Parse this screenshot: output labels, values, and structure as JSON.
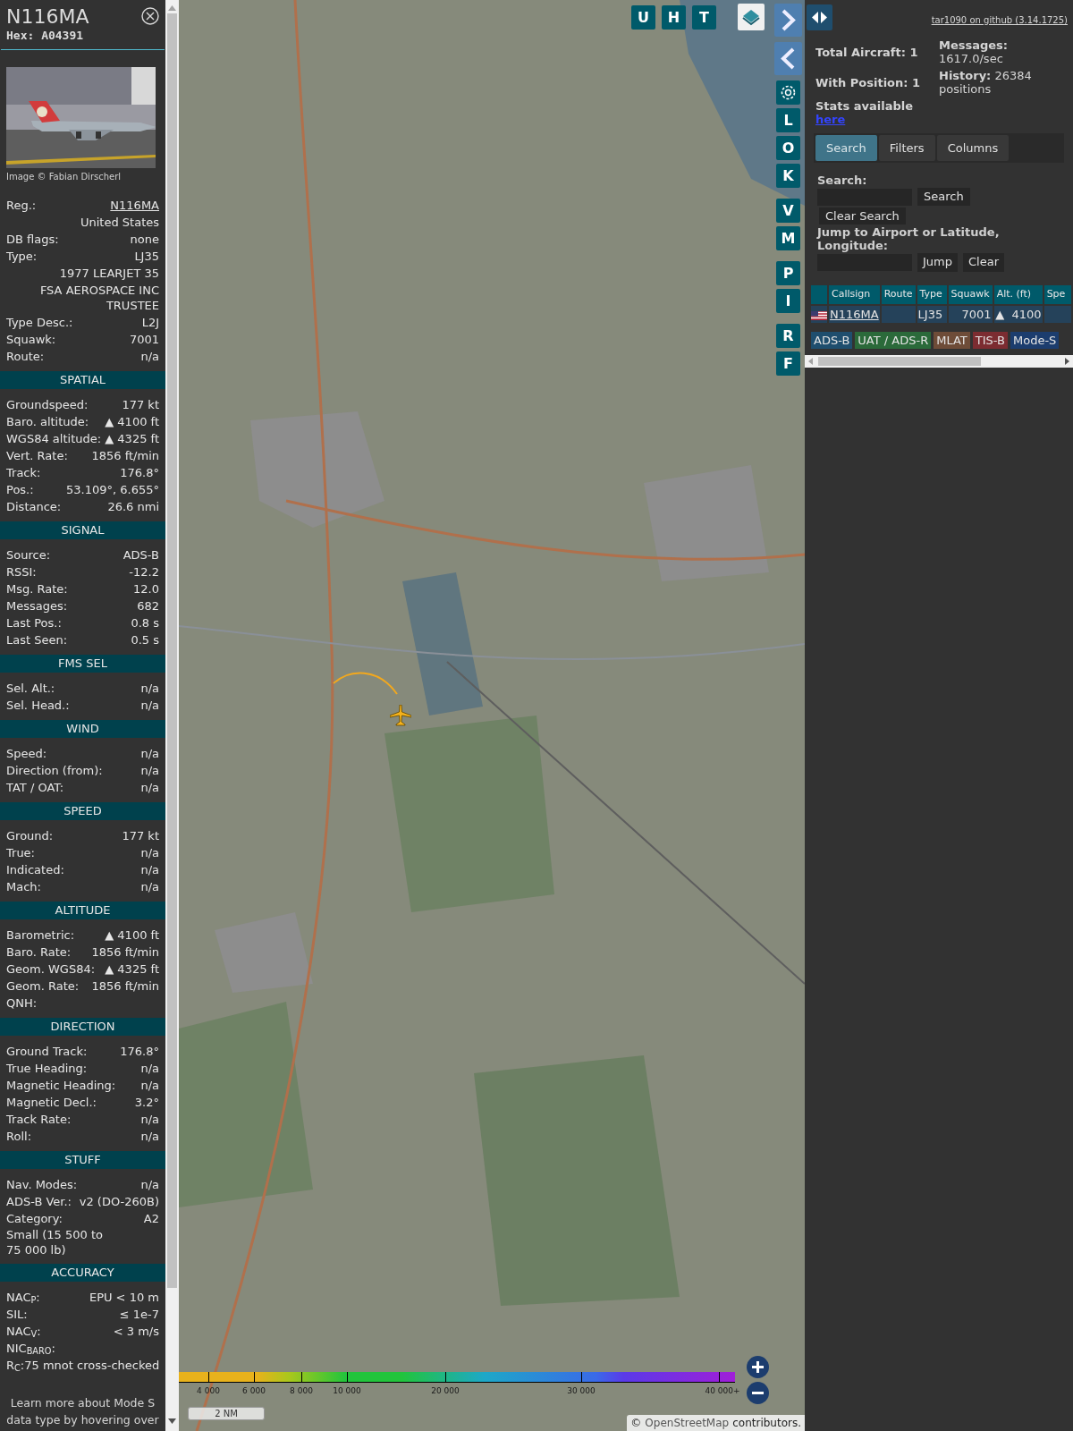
{
  "aircraft": {
    "callsign": "N116MA",
    "hex": "Hex: A04391"
  },
  "photo": {
    "kind": "picture",
    "credit": "Image © Fabian Dirscherl"
  },
  "details": [
    {
      "kind": "pair",
      "label": "Reg.:",
      "value": "N116MA",
      "link": true
    },
    {
      "kind": "value",
      "value": "United States"
    },
    {
      "kind": "pair",
      "label": "DB flags:",
      "value": "none"
    },
    {
      "kind": "pair",
      "label": "Type:",
      "value": "LJ35"
    },
    {
      "kind": "value",
      "value": "1977 LEARJET 35"
    },
    {
      "kind": "value",
      "value": "FSA AEROSPACE INC TRUSTEE"
    },
    {
      "kind": "pair",
      "label": "Type Desc.:",
      "value": "L2J"
    },
    {
      "kind": "pair",
      "label": "Squawk:",
      "value": "7001"
    },
    {
      "kind": "pair",
      "label": "Route:",
      "value": "n/a"
    }
  ],
  "sections": [
    {
      "title": "SPATIAL",
      "rows": [
        {
          "kind": "pair",
          "label": "Groundspeed:",
          "value": "177 kt"
        },
        {
          "kind": "pair",
          "label": "Baro. altitude:",
          "value": "▲ 4100 ft"
        },
        {
          "kind": "pair",
          "label": "WGS84 altitude:",
          "value": "▲ 4325 ft"
        },
        {
          "kind": "pair",
          "label": "Vert. Rate:",
          "value": "1856 ft/min"
        },
        {
          "kind": "pair",
          "label": "Track:",
          "value": "176.8°"
        },
        {
          "kind": "pair",
          "label": "Pos.:",
          "value": "53.109°, 6.655°"
        },
        {
          "kind": "pair",
          "label": "Distance:",
          "value": "26.6 nmi"
        }
      ]
    },
    {
      "title": "SIGNAL",
      "rows": [
        {
          "kind": "pair",
          "label": "Source:",
          "value": "ADS-B"
        },
        {
          "kind": "pair",
          "label": "RSSI:",
          "value": "-12.2"
        },
        {
          "kind": "pair",
          "label": "Msg. Rate:",
          "value": "12.0"
        },
        {
          "kind": "pair",
          "label": "Messages:",
          "value": "682"
        },
        {
          "kind": "pair",
          "label": "Last Pos.:",
          "value": "0.8 s"
        },
        {
          "kind": "pair",
          "label": "Last Seen:",
          "value": "0.5 s"
        }
      ]
    },
    {
      "title": "FMS SEL",
      "rows": [
        {
          "kind": "pair",
          "label": "Sel. Alt.:",
          "value": "n/a"
        },
        {
          "kind": "pair",
          "label": "Sel. Head.:",
          "value": "n/a"
        }
      ]
    },
    {
      "title": "WIND",
      "rows": [
        {
          "kind": "pair",
          "label": "Speed:",
          "value": "n/a"
        },
        {
          "kind": "pair",
          "label": "Direction (from):",
          "value": "n/a"
        },
        {
          "kind": "pair",
          "label": "TAT / OAT:",
          "value": "n/a"
        }
      ]
    },
    {
      "title": "SPEED",
      "rows": [
        {
          "kind": "pair",
          "label": "Ground:",
          "value": "177 kt"
        },
        {
          "kind": "pair",
          "label": "True:",
          "value": "n/a"
        },
        {
          "kind": "pair",
          "label": "Indicated:",
          "value": "n/a"
        },
        {
          "kind": "pair",
          "label": "Mach:",
          "value": "n/a"
        }
      ]
    },
    {
      "title": "ALTITUDE",
      "rows": [
        {
          "kind": "pair",
          "label": "Barometric:",
          "value": "▲ 4100 ft"
        },
        {
          "kind": "pair",
          "label": "Baro. Rate:",
          "value": "1856 ft/min"
        },
        {
          "kind": "pair",
          "label": "Geom. WGS84:",
          "value": "▲ 4325 ft"
        },
        {
          "kind": "pair",
          "label": "Geom. Rate:",
          "value": "1856 ft/min"
        },
        {
          "kind": "pair",
          "label": "QNH:"
        }
      ]
    },
    {
      "title": "DIRECTION",
      "rows": [
        {
          "kind": "pair",
          "label": "Ground Track:",
          "value": "176.8°"
        },
        {
          "kind": "pair",
          "label": "True Heading:",
          "value": "n/a"
        },
        {
          "kind": "pair",
          "label": "Magnetic Heading:",
          "value": "n/a"
        },
        {
          "kind": "pair",
          "label": "Magnetic Decl.:",
          "value": "3.2°"
        },
        {
          "kind": "pair",
          "label": "Track Rate:",
          "value": "n/a"
        },
        {
          "kind": "pair",
          "label": "Roll:",
          "value": "n/a"
        }
      ]
    },
    {
      "title": "STUFF",
      "rows": [
        {
          "kind": "pair",
          "label": "Nav. Modes:",
          "value": "n/a"
        },
        {
          "kind": "pair",
          "label": "ADS-B Ver.:",
          "value": "v2 (DO-260B)"
        },
        {
          "kind": "pair",
          "label": "Category:",
          "value": "A2"
        },
        {
          "kind": "note",
          "value": "Small (15 500 to 75 000 lb)"
        }
      ]
    },
    {
      "title": "ACCURACY",
      "rows": [
        {
          "kind": "pair",
          "label": "NAC$_{P}$:",
          "value": "EPU < 10 m"
        },
        {
          "kind": "pair",
          "label": "SIL:",
          "value": "≤ 1e-7"
        },
        {
          "kind": "pair",
          "label": "NAC$_{V}$:",
          "value": "< 3 m/s"
        },
        {
          "kind": "pair",
          "label": "NIC$_{BARO}$:"
        },
        {
          "kind": "note",
          "value": "R$_{C}$:75 mnot cross-checked"
        }
      ]
    }
  ],
  "footer": "Learn more about Mode S data type by hovering over",
  "map": {
    "kind": "picture",
    "top_buttons": [
      "U",
      "H",
      "T"
    ],
    "side_buttons": [
      [
        "L",
        "O",
        "K"
      ],
      [
        "V",
        "M"
      ],
      [
        "P",
        "I"
      ],
      [
        "R",
        "F"
      ]
    ],
    "altitude_legend": [
      "4 000",
      "6 000",
      "8 000",
      "10 000",
      "20 000",
      "30 000",
      "40 000+"
    ],
    "scale": "2 NM",
    "attribution_symbol": "©",
    "attribution_link": "OpenStreetMap",
    "attribution_rest": "contributors."
  },
  "header": {
    "link": "tar1090 on github (3.14.1725)"
  },
  "stats": {
    "total": "Total Aircraft: 1",
    "with_position": "With Position: 1",
    "stats_label": "Stats available",
    "stats_link": "here",
    "messages_label": "Messages:",
    "messages_value": "1617.0/sec",
    "history": "**History:** 26384 positions"
  },
  "tabs": [
    {
      "label": "Search",
      "selected": true
    },
    {
      "label": "Filters",
      "selected": false
    },
    {
      "label": "Columns",
      "selected": false
    }
  ],
  "search": {
    "label": "Search:",
    "button": "Search",
    "clear": "Clear Search",
    "jump_label": "Jump to Airport or Latitude, Longitude:",
    "jump": "Jump",
    "jump_clear": "Clear"
  },
  "table": {
    "columns": [
      "Callsign",
      "Route",
      "Type",
      "Squawk",
      "Alt. (ft)",
      "Spe"
    ],
    "rows": [
      {
        "callsign": "N116MA",
        "type": "LJ35",
        "squawk": "7001",
        "altitude": "▲  4100"
      }
    ]
  },
  "legend": [
    {
      "label": "ADS-B",
      "color": "#1f4e6e"
    },
    {
      "label": "UAT / ADS-R",
      "color": "#2b6a3a"
    },
    {
      "label": "MLAT",
      "color": "#6e4c38"
    },
    {
      "label": "TIS-B",
      "color": "#7c2c31"
    },
    {
      "label": "Mode-S",
      "color": "#1c3d6e"
    }
  ]
}
